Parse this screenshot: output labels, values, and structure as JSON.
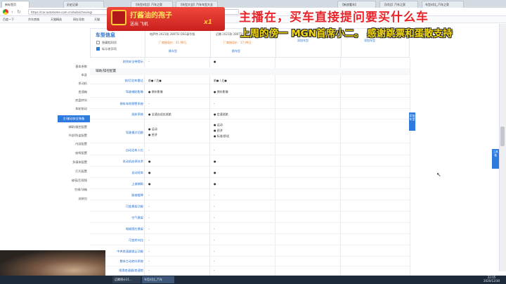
{
  "browser": {
    "tabs": [
      "新标签页",
      "历史记录",
      "【车型对比】汽车之家",
      "【车型大全】汽车车型大全",
      "【新浪看车】",
      "【对比】汽车之家",
      "车型对比_汽车之家"
    ],
    "url": "https://car.autohome.com.cn/duibi/chexing/",
    "bookmarks": [
      "百度一下",
      "京东商城",
      "天猫精选",
      "网址导航",
      "天猫"
    ]
  },
  "header": {
    "section_title": "车型信息",
    "hide_same_label": "隐藏相同项",
    "highlight_diff_label": "标示差异项",
    "cars": [
      {
        "name": "帕萨特 2021款 280TSI DSG豪华版",
        "price": "厂商指导价：21.99万",
        "link": "换车型"
      },
      {
        "name": "迈腾 2021款 280TSI DSG豪华型",
        "price": "厂商指导价：17.99万",
        "link": "换车型"
      }
    ],
    "add_car_link": "添加车型"
  },
  "nav": {
    "items": [
      "基本参数",
      "车身",
      "发动机",
      "变速箱",
      "底盘转向",
      "车轮制动",
      "主/被动安全装备",
      "辅助/操控配置",
      "外部/防盗配置",
      "内部配置",
      "座椅配置",
      "多媒体配置",
      "灯光配置",
      "玻璃/后视镜",
      "空调/冰箱",
      "选装包"
    ],
    "active_index": 6
  },
  "table": {
    "top_row": {
      "label": "前排安全带提示",
      "v1": "-",
      "v2": "●"
    },
    "section": "辅助/操控配置",
    "rows": [
      {
        "label": "前/后驻车雷达",
        "v1": "前● / 后●",
        "v2": "前● / 后●"
      },
      {
        "label": "驾驶辅助影像",
        "v1": "● 倒车影像",
        "v2": "● 倒车影像"
      },
      {
        "label": "倒车车侧预警系统",
        "v1": "-",
        "v2": "-"
      },
      {
        "label": "巡航系统",
        "v1": "● 全速自适应巡航",
        "v2": "● 定速巡航"
      },
      {
        "label": "驾驶模式切换",
        "v1": "● 运动\n● 经济",
        "v2": "● 运动\n● 经济\n● 标准/舒适"
      },
      {
        "label": "自动泊车入位",
        "v1": "-",
        "v2": "-"
      },
      {
        "label": "发动机启停技术",
        "v1": "●",
        "v2": "●"
      },
      {
        "label": "自动驻车",
        "v1": "●",
        "v2": "●"
      },
      {
        "label": "上坡辅助",
        "v1": "●",
        "v2": "●"
      },
      {
        "label": "陡坡缓降",
        "v1": "-",
        "v2": "-"
      },
      {
        "label": "可变悬架功能",
        "v1": "-",
        "v2": "-"
      },
      {
        "label": "空气悬架",
        "v1": "-",
        "v2": "-"
      },
      {
        "label": "电磁感应悬架",
        "v1": "-",
        "v2": "-"
      },
      {
        "label": "可变转向比",
        "v1": "-",
        "v2": "-"
      },
      {
        "label": "中央差速器锁止功能",
        "v1": "-",
        "v2": "-"
      },
      {
        "label": "整体主动转向系统",
        "v1": "-",
        "v2": "-"
      },
      {
        "label": "限滑差速器/差速锁",
        "v1": "-",
        "v2": "-"
      }
    ]
  },
  "float_button": "添加车型",
  "side_tool": "工具箱",
  "overlay": {
    "gift_title": "打酱油的孢子",
    "gift_sub": "送出  飞机",
    "gift_count": "x1",
    "line1": "主播在，买车直接提问要买什么车",
    "line2": "上周的傍一 MGN首席小二。 感谢跳票和蛋散支持"
  },
  "taskbar": {
    "items": [
      "迈腾预计21...",
      "车型对比_汽车"
    ],
    "time": "22:05",
    "date": "2020/12/30"
  }
}
